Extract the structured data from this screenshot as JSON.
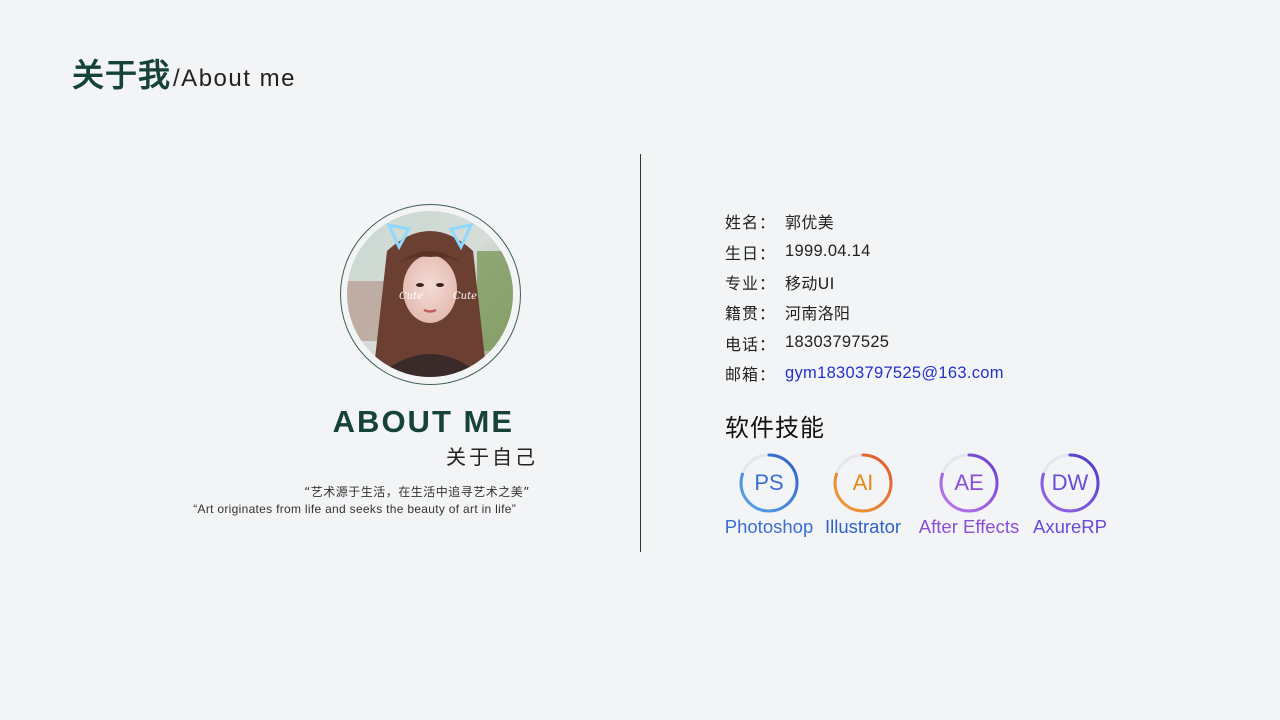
{
  "header": {
    "title_cn": "关于我",
    "title_en": "/About me"
  },
  "about": {
    "heading": "ABOUT ME",
    "subheading": "关于自己",
    "quote_cn": "“艺术源于生活，在生活中追寻艺术之美”",
    "quote_en": "“Art originates from life and seeks the beauty of art in life”"
  },
  "avatar": {
    "sticker_text": "Cute"
  },
  "info": [
    {
      "label": "姓名",
      "sep": "：",
      "value": "郭优美"
    },
    {
      "label": "生日",
      "sep": "：",
      "value": "1999.04.14"
    },
    {
      "label": "专业",
      "sep": "：",
      "value": "移动UI"
    },
    {
      "label": "籍贯",
      "sep": "：",
      "value": "河南洛阳"
    },
    {
      "label": "电话",
      "sep": "：",
      "value": "18303797525"
    },
    {
      "label": "邮箱",
      "sep": "：",
      "value": "gym18303797525@163.com"
    }
  ],
  "skills_title": "软件技能",
  "skills": [
    {
      "abbr": "PS",
      "name": "Photoshop",
      "color": "#3a6fd0",
      "ring_start": "#5aa8e8",
      "ring_end": "#2f5fc8",
      "level": 0.8
    },
    {
      "abbr": "AI",
      "name": "Illustrator",
      "color": "#e08a18",
      "name_color": "#2f63c4",
      "ring_start": "#f0a23a",
      "ring_end": "#e0572a",
      "level": 0.8
    },
    {
      "abbr": "AE",
      "name": "After Effects",
      "color": "#8a4fd4",
      "ring_start": "#c07aee",
      "ring_end": "#6a3ed0",
      "level": 0.8
    },
    {
      "abbr": "DW",
      "name": "AxureRP",
      "color": "#6a4ad8",
      "ring_start": "#9a6ae8",
      "ring_end": "#4a3ac8",
      "level": 0.8
    }
  ],
  "colors": {
    "accent_dark_green": "#17423a",
    "background": "#f2f4f6",
    "email_link": "#2330c8"
  }
}
